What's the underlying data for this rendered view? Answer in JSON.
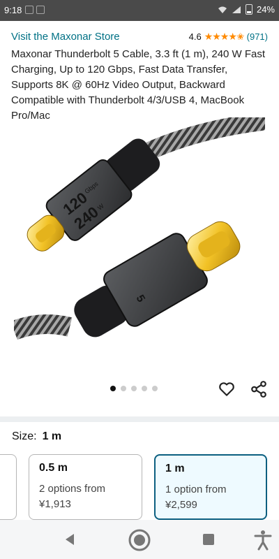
{
  "status_bar": {
    "time": "9:18",
    "battery": "24%"
  },
  "store": {
    "link": "Visit the Maxonar Store",
    "rating": "4.6",
    "stars": "★★★★✬",
    "count": "(971)"
  },
  "product": {
    "title": "Maxonar Thunderbolt 5 Cable, 3.3 ft (1 m), 240 W Fast Charging, Up to 120 Gbps, Fast Data Transfer, Supports 8K @ 60Hz Video Output, Backward Compatible with Thunderbolt 4/3/USB 4, MacBook Pro/Mac",
    "connector_text_1": "120",
    "connector_text_1_unit": "Gbps",
    "connector_text_2": "240",
    "connector_text_2_unit": "W",
    "connector_text_3": "5"
  },
  "carousel": {
    "total": 5,
    "active": 0
  },
  "size": {
    "label": "Size:",
    "selected": "1 m",
    "options": [
      {
        "name": "0.5 m",
        "line1": "2 options from",
        "price": "¥1,913"
      },
      {
        "name": "1 m",
        "line1": "1 option from",
        "price": "¥2,599"
      }
    ]
  },
  "colors": {
    "link": "#007185",
    "star": "#ff8a00",
    "selected_border": "#0b5f80"
  }
}
